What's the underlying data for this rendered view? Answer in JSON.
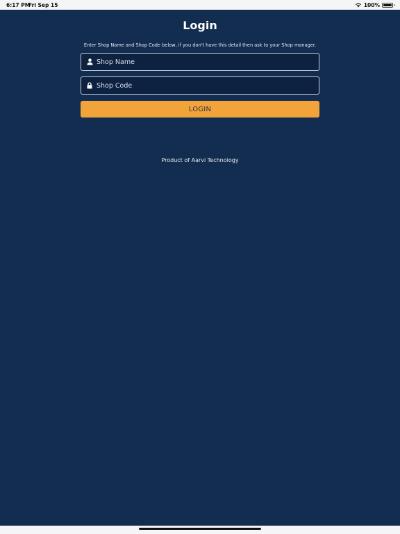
{
  "status_bar": {
    "time": "6:17 PM",
    "date": "Fri Sep 15",
    "battery_text": "100%",
    "battery_level": 1.0,
    "icons": [
      "wifi-icon",
      "battery-icon"
    ]
  },
  "login": {
    "title": "Login",
    "instruction": "Enter Shop Name and Shop Code below, if you don't have this detail then ask to your Shop manager.",
    "shop_name": {
      "placeholder": "Shop Name",
      "value": "",
      "icon": "user-icon"
    },
    "shop_code": {
      "placeholder": "Shop Code",
      "value": "",
      "icon": "lock-icon"
    },
    "button_label": "LOGIN"
  },
  "footer": {
    "text": "Product of Aarvi Technology"
  },
  "colors": {
    "background": "#132d50",
    "field_background": "#0d2140",
    "accent": "#f2a33a",
    "text": "#ffffff"
  }
}
